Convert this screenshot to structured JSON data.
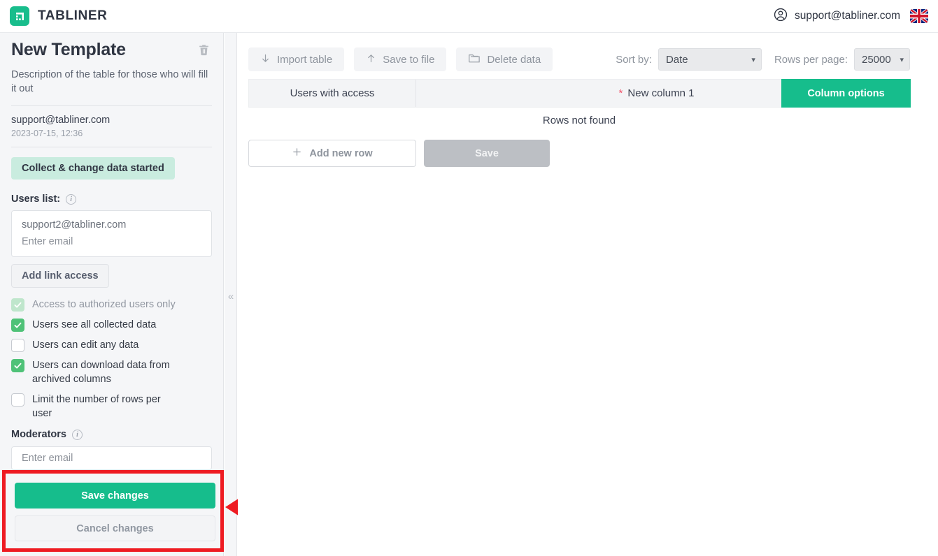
{
  "app": {
    "brand_name": "TABLINER",
    "logo_icon": "table-logo-icon",
    "accent_green": "#16bd8c",
    "highlight_red": "#ee1b22"
  },
  "topbar": {
    "account_icon": "user-circle-icon",
    "account_email": "support@tabliner.com",
    "language_icon": "uk-flag-icon"
  },
  "sidebar": {
    "title": "New Template",
    "delete_icon": "trash-icon",
    "description": "Description of the table for those who will fill it out",
    "owner_email": "support@tabliner.com",
    "owner_date": "2023-07-15, 12:36",
    "status_badge": "Collect & change data started",
    "users_list_label": "Users list:",
    "users_list_info_icon": "info-icon",
    "users_list_entries": [
      "support2@tabliner.com"
    ],
    "users_list_placeholder": "Enter email",
    "add_link_access": "Add link access",
    "checkboxes": [
      {
        "label": "Access to authorized users only",
        "checked": true,
        "disabled": true
      },
      {
        "label": "Users see all collected data",
        "checked": true,
        "disabled": false
      },
      {
        "label": "Users can edit any data",
        "checked": false,
        "disabled": false
      },
      {
        "label": "Users can download data from archived columns",
        "checked": true,
        "disabled": false
      },
      {
        "label": "Limit the number of rows per user",
        "checked": false,
        "disabled": false
      }
    ],
    "moderators_label": "Moderators",
    "moderators_info_icon": "info-icon",
    "moderators_placeholder": "Enter email",
    "save_changes": "Save changes",
    "cancel_changes": "Cancel changes",
    "collapse_icon": "double-chevron-left-icon"
  },
  "toolbar": {
    "import_table": "Import table",
    "import_icon": "arrow-down-icon",
    "save_to_file": "Save to file",
    "save_to_file_icon": "arrow-up-icon",
    "delete_data": "Delete data",
    "delete_data_icon": "folder-icon",
    "sort_by_label": "Sort by:",
    "sort_by_value": "Date",
    "rows_per_page_label": "Rows per page:",
    "rows_per_page_value": "25000",
    "chevron_icon": "chevron-down-icon"
  },
  "table": {
    "col_users_with_access": "Users with access",
    "col_new_column_1": "New column 1",
    "required_marker": "*",
    "column_options": "Column options",
    "empty_message": "Rows not found",
    "add_new_row": "Add new row",
    "add_icon": "plus-icon",
    "save": "Save"
  },
  "annotation": {
    "arrow_icon": "left-arrow-annotation",
    "arrow_color": "#ee1b22"
  }
}
